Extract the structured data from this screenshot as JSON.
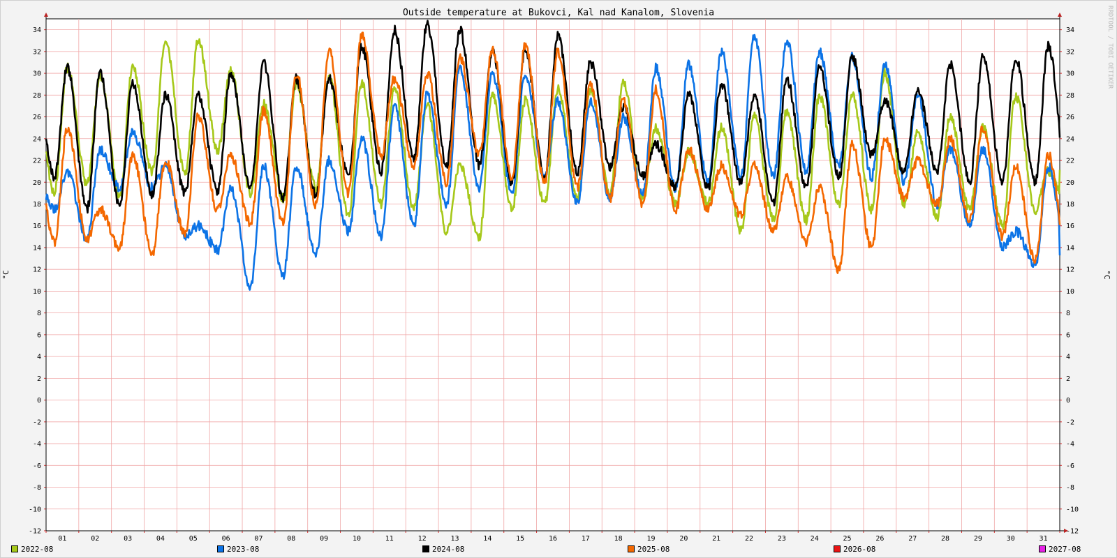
{
  "chart_data": {
    "type": "line",
    "title": "Outside temperature at Bukovci, Kal nad Kanalom, Slovenia",
    "ylabel": "°C",
    "ylabel_right": "°C",
    "watermark": "RRDTOOL / TOBI OETIKER",
    "x_ticks": [
      "01",
      "02",
      "03",
      "04",
      "05",
      "06",
      "07",
      "08",
      "09",
      "10",
      "11",
      "12",
      "13",
      "14",
      "15",
      "16",
      "17",
      "18",
      "19",
      "20",
      "21",
      "22",
      "23",
      "24",
      "25",
      "26",
      "27",
      "28",
      "29",
      "30",
      "31"
    ],
    "y_ticks": [
      34,
      32,
      30,
      28,
      26,
      24,
      22,
      20,
      18,
      16,
      14,
      12,
      10,
      8,
      6,
      4,
      2,
      0,
      -2,
      -4,
      -6,
      -8,
      -10,
      -12
    ],
    "xlim": [
      1,
      32
    ],
    "ylim": [
      -12,
      35
    ],
    "grid": true,
    "legend_position": "bottom",
    "series": [
      {
        "name": "2022-08",
        "color": "#a6c81a",
        "daily_max": [
          30.5,
          29.8,
          30.5,
          32.9,
          33.0,
          30.2,
          27.2,
          29.0,
          29.8,
          29.0,
          28.5,
          27.0,
          21.5,
          28.0,
          27.5,
          28.5,
          28.5,
          29.3,
          25.0,
          22.8,
          25.0,
          26.0,
          26.5,
          28.0,
          28.0,
          30.0,
          24.5,
          26.0,
          25.0,
          28.0,
          21.0
        ],
        "daily_min": [
          19.0,
          19.8,
          18.8,
          21.0,
          20.8,
          23.0,
          19.0,
          18.5,
          19.5,
          17.0,
          18.0,
          17.5,
          15.5,
          15.0,
          17.5,
          18.0,
          18.5,
          19.0,
          18.5,
          18.0,
          18.0,
          15.5,
          16.5,
          16.5,
          18.0,
          17.5,
          18.0,
          16.8,
          17.5,
          16.0,
          17.5
        ]
      },
      {
        "name": "2023-08",
        "color": "#0c73e6",
        "daily_max": [
          21.0,
          23.0,
          24.5,
          21.5,
          16.0,
          19.5,
          21.5,
          21.5,
          22.0,
          24.0,
          27.0,
          28.0,
          30.5,
          30.0,
          30.0,
          27.5,
          27.5,
          26.0,
          30.5,
          30.8,
          32.0,
          33.5,
          33.0,
          32.0,
          31.5,
          30.8,
          28.0,
          23.0,
          23.0,
          15.5,
          21.5
        ],
        "daily_min": [
          17.5,
          14.8,
          19.5,
          19.5,
          15.0,
          13.8,
          10.5,
          11.5,
          13.5,
          15.5,
          15.0,
          16.0,
          18.0,
          19.5,
          19.0,
          20.5,
          18.0,
          18.5,
          19.0,
          19.5,
          20.0,
          20.5,
          20.5,
          21.0,
          21.5,
          20.5,
          20.0,
          18.0,
          16.0,
          14.0,
          12.5
        ]
      },
      {
        "name": "2024-08",
        "color": "#000000",
        "daily_max": [
          30.5,
          30.0,
          29.0,
          28.0,
          28.0,
          30.0,
          31.0,
          29.5,
          29.5,
          32.5,
          34.0,
          34.5,
          34.0,
          32.0,
          32.0,
          33.5,
          31.0,
          27.0,
          23.5,
          28.0,
          29.0,
          28.0,
          29.5,
          30.5,
          31.5,
          27.5,
          28.5,
          30.8,
          31.5,
          31.5,
          32.5
        ],
        "daily_min": [
          20.5,
          17.5,
          17.8,
          18.8,
          19.0,
          19.2,
          19.5,
          18.5,
          18.8,
          20.5,
          21.0,
          22.0,
          21.5,
          21.5,
          20.0,
          20.5,
          21.0,
          21.5,
          20.5,
          19.5,
          19.5,
          20.0,
          18.0,
          19.5,
          20.5,
          22.5,
          21.0,
          21.0,
          20.0,
          20.0,
          20.0
        ]
      },
      {
        "name": "2025-08",
        "color": "#f46800",
        "daily_max": [
          25.0,
          17.5,
          22.5,
          22.0,
          26.0,
          22.5,
          26.5,
          30.0,
          32.2,
          33.5,
          29.5,
          30.0,
          31.5,
          32.2,
          32.5,
          32.0,
          29.0,
          27.5,
          28.5,
          23.0,
          21.5,
          21.5,
          20.5,
          19.5,
          23.5,
          24.0,
          22.0,
          24.0,
          25.0,
          21.5,
          22.5
        ],
        "daily_min": [
          14.5,
          14.8,
          14.0,
          13.5,
          15.2,
          17.5,
          16.2,
          16.2,
          18.0,
          19.0,
          22.5,
          21.5,
          20.0,
          22.5,
          20.5,
          20.0,
          19.5,
          18.5,
          18.0,
          17.5,
          17.5,
          17.0,
          15.5,
          14.5,
          12.0,
          14.0,
          18.5,
          18.0,
          16.5,
          15.0,
          12.8
        ]
      },
      {
        "name": "2026-08",
        "color": "#e81414",
        "daily_max": [],
        "daily_min": []
      },
      {
        "name": "2027-08",
        "color": "#e622e6",
        "daily_max": [],
        "daily_min": []
      }
    ]
  }
}
